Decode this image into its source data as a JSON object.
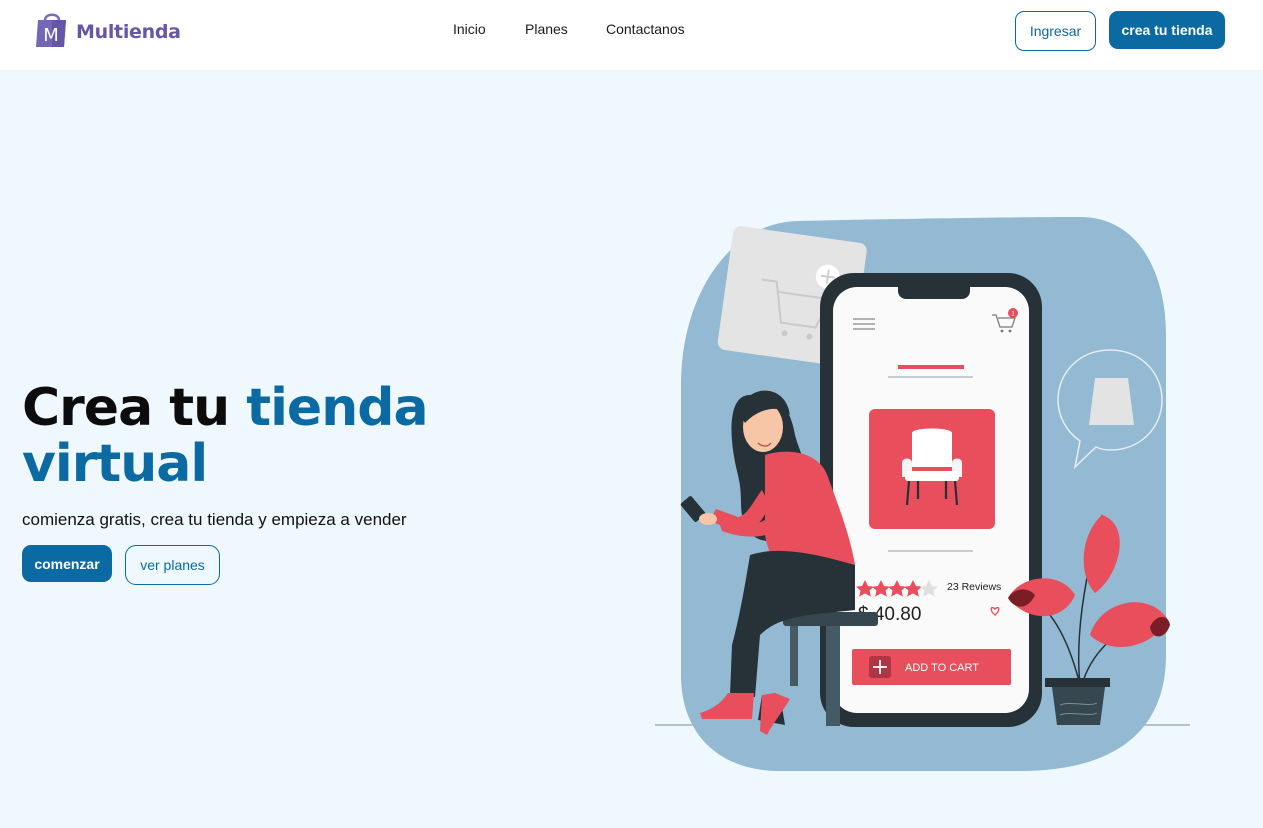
{
  "brand": {
    "name": "Multienda",
    "logo_letter": "M"
  },
  "nav": {
    "items": [
      "Inicio",
      "Planes",
      "Contactanos"
    ]
  },
  "header": {
    "login_label": "Ingresar",
    "create_label": "crea tu tienda"
  },
  "hero": {
    "title_part1": "Crea tu ",
    "title_accent1": "tienda",
    "title_accent2": "virtual",
    "subtitle": "comienza gratis, crea tu tienda y empieza a vender",
    "start_label": "comenzar",
    "plans_label": "ver planes"
  },
  "illustration": {
    "reviews": "23 Reviews",
    "price": "$ 40.80",
    "add_to_cart": "ADD TO CART",
    "cart_count": "1",
    "rating": 4
  },
  "colors": {
    "accent": "#0b6aa2",
    "brand": "#6656a8",
    "coral": "#e84e5b",
    "blob": "#93bad2"
  }
}
